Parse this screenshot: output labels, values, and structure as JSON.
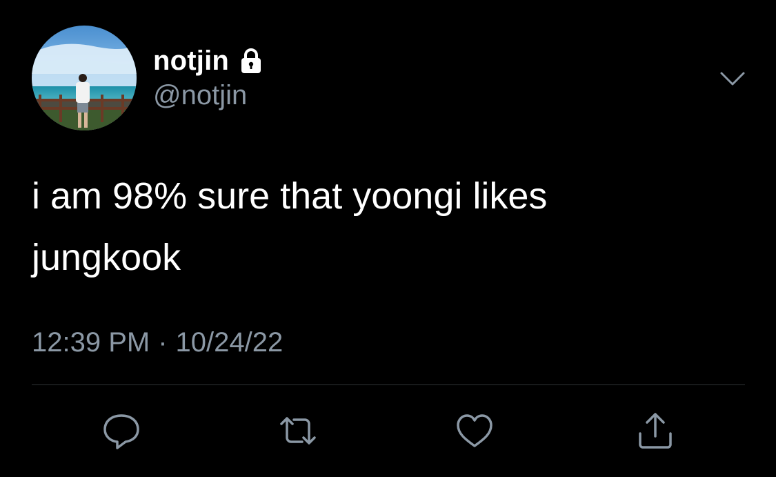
{
  "author": {
    "display_name": "notjin",
    "handle": "@notjin",
    "protected_icon": "lock-icon"
  },
  "tweet": {
    "text": "i am 98% sure that yoongi likes\njungkook",
    "time": "12:39 PM",
    "separator": "·",
    "date": "10/24/22"
  },
  "actions": [
    {
      "icon": "reply-icon"
    },
    {
      "icon": "retweet-icon"
    },
    {
      "icon": "like-icon"
    },
    {
      "icon": "share-icon"
    }
  ],
  "colors": {
    "background": "#000000",
    "primary_text": "#ffffff",
    "secondary_text": "#8b98a5",
    "divider": "#2f3336"
  }
}
